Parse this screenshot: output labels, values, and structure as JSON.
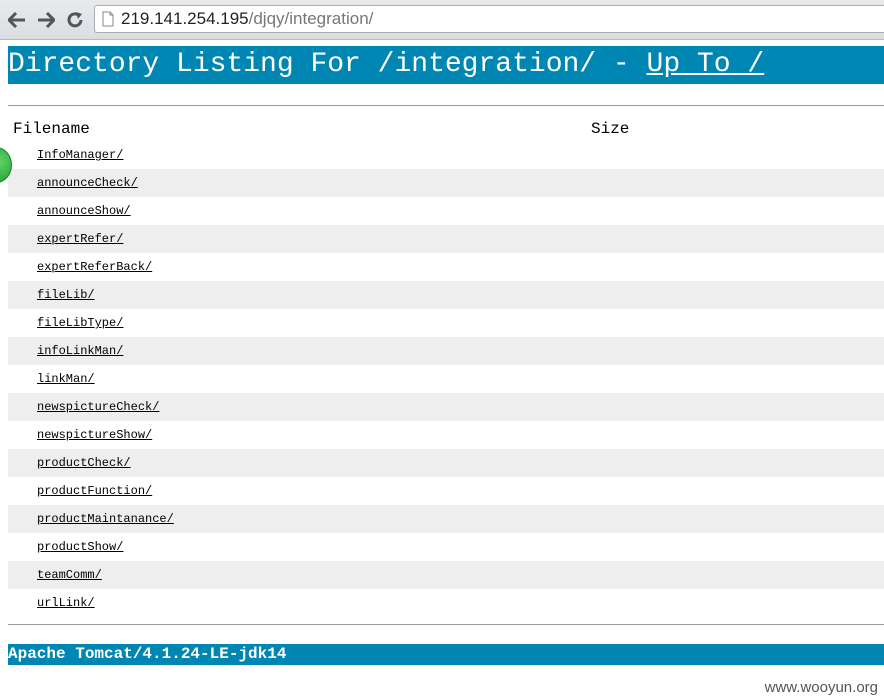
{
  "browser": {
    "url_host": "219.141.254.195",
    "url_path": "/djqy/integration/"
  },
  "page": {
    "header_prefix": "Directory Listing For /integration/ - ",
    "header_link": "Up To /",
    "columns": {
      "filename": "Filename",
      "size": "Size"
    },
    "rows": [
      {
        "name": "InfoManager/"
      },
      {
        "name": "announceCheck/"
      },
      {
        "name": "announceShow/"
      },
      {
        "name": "expertRefer/"
      },
      {
        "name": "expertReferBack/"
      },
      {
        "name": "fileLib/"
      },
      {
        "name": "fileLibType/"
      },
      {
        "name": "infoLinkMan/"
      },
      {
        "name": "linkMan/"
      },
      {
        "name": "newspictureCheck/"
      },
      {
        "name": "newspictureShow/"
      },
      {
        "name": "productCheck/"
      },
      {
        "name": "productFunction/"
      },
      {
        "name": "productMaintanance/"
      },
      {
        "name": "productShow/"
      },
      {
        "name": "teamComm/"
      },
      {
        "name": "urlLink/"
      }
    ],
    "footer": "Apache Tomcat/4.1.24-LE-jdk14"
  },
  "watermark": "www.wooyun.org",
  "colors": {
    "header_bg": "#0086b2",
    "row_alt": "#eeeeee"
  }
}
